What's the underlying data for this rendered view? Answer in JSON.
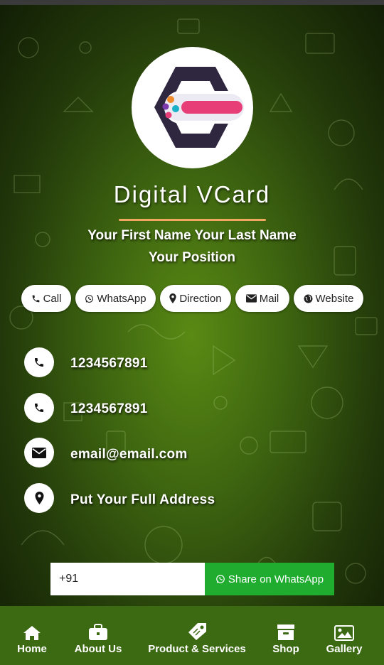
{
  "header": {
    "title": "Digital VCard",
    "full_name": "Your First Name Your Last Name",
    "position": "Your Position"
  },
  "actions": [
    {
      "label": "Call",
      "icon": "phone-icon"
    },
    {
      "label": "WhatsApp",
      "icon": "whatsapp-icon"
    },
    {
      "label": "Direction",
      "icon": "map-marker-icon"
    },
    {
      "label": "Mail",
      "icon": "envelope-icon"
    },
    {
      "label": "Website",
      "icon": "globe-icon"
    }
  ],
  "contacts": [
    {
      "icon": "phone-icon",
      "value": "1234567891"
    },
    {
      "icon": "phone-icon",
      "value": "1234567891"
    },
    {
      "icon": "envelope-icon",
      "value": "email@email.com"
    },
    {
      "icon": "map-marker-icon",
      "value": "Put Your Full Address"
    }
  ],
  "share": {
    "input_value": "+91",
    "button_label": "Share on WhatsApp"
  },
  "nav": [
    {
      "label": "Home",
      "icon": "home-icon"
    },
    {
      "label": "About Us",
      "icon": "briefcase-icon"
    },
    {
      "label": "Product & Services",
      "icon": "tag-icon"
    },
    {
      "label": "Shop",
      "icon": "archive-icon"
    },
    {
      "label": "Gallery",
      "icon": "image-icon"
    }
  ],
  "colors": {
    "accent_underline": "#f0a860",
    "whatsapp_green": "#1fac2f",
    "navbar_bg": "#3c6a12",
    "logo_dark": "#2f2640",
    "logo_pink": "#e83e78"
  }
}
